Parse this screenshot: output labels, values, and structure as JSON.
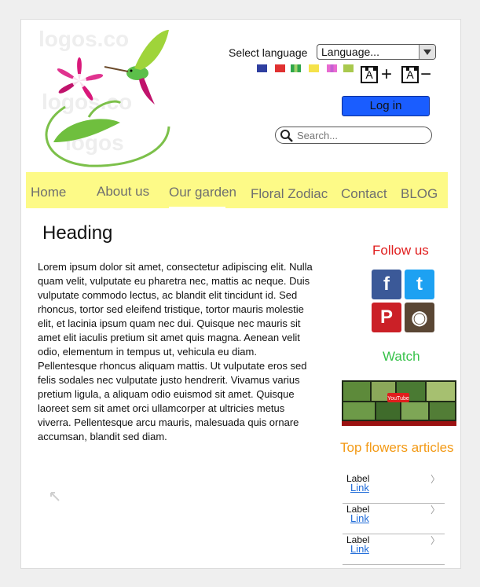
{
  "header": {
    "language_label": "Select language",
    "language_select_value": "Language...",
    "login_label": "Log in",
    "search_placeholder": "Search...",
    "flag_colors": [
      [
        "#2f3fa0",
        "#2f3fa0",
        "#2f3fa0"
      ],
      [
        "#e03131",
        "#e03131",
        "#e03131"
      ],
      [
        "#2fa64a",
        "#9fd06a",
        "#2fa64a"
      ],
      [
        "#f5e24a",
        "#f5e24a",
        "#f5e24a"
      ],
      [
        "#e86bd1",
        "#c65fd3",
        "#e86bd1"
      ],
      [
        "#a9c94e",
        "#a9c94e",
        "#a9c94e"
      ]
    ],
    "font_increase_symbol": "+",
    "font_decrease_symbol": "−",
    "font_glyph": "A"
  },
  "nav": {
    "items": [
      "Home",
      "About us",
      "Our garden",
      "Floral Zodiac",
      "Contact",
      "BLOG"
    ]
  },
  "main": {
    "heading": "Heading",
    "body": "Lorem ipsum dolor sit amet, consectetur adipiscing elit. Nulla quam velit, vulputate eu pharetra nec, mattis ac neque. Duis vulputate commodo lectus, ac blandit elit tincidunt id. Sed rhoncus, tortor sed eleifend tristique, tortor mauris molestie elit, et lacinia ipsum quam nec dui. Quisque nec mauris sit amet elit iaculis pretium sit amet quis magna. Aenean velit odio, elementum in tempus ut, vehicula eu diam. Pellentesque rhoncus aliquam mattis. Ut vulputate eros sed felis sodales nec vulputate justo hendrerit. Vivamus varius pretium ligula, a aliquam odio euismod sit amet. Quisque laoreet sem sit amet orci ullamcorper at ultricies metus viverra. Pellentesque arcu mauris, malesuada quis ornare accumsan, blandit sed diam."
  },
  "sidebar": {
    "follow_title": "Follow us",
    "social": [
      {
        "name": "facebook-icon",
        "glyph": "f",
        "color": "#3b5998"
      },
      {
        "name": "twitter-icon",
        "glyph": "t",
        "color": "#1da1f2"
      },
      {
        "name": "pinterest-icon",
        "glyph": "P",
        "color": "#cb2027"
      },
      {
        "name": "instagram-icon",
        "glyph": "◉",
        "color": "#5a4634"
      }
    ],
    "watch_title": "Watch",
    "youtube_label": "YouTube",
    "articles_title": "Top flowers articles",
    "articles": [
      {
        "label": "Label",
        "link": "Link"
      },
      {
        "label": "Label",
        "link": "Link"
      },
      {
        "label": "Label",
        "link": "Link"
      }
    ]
  }
}
